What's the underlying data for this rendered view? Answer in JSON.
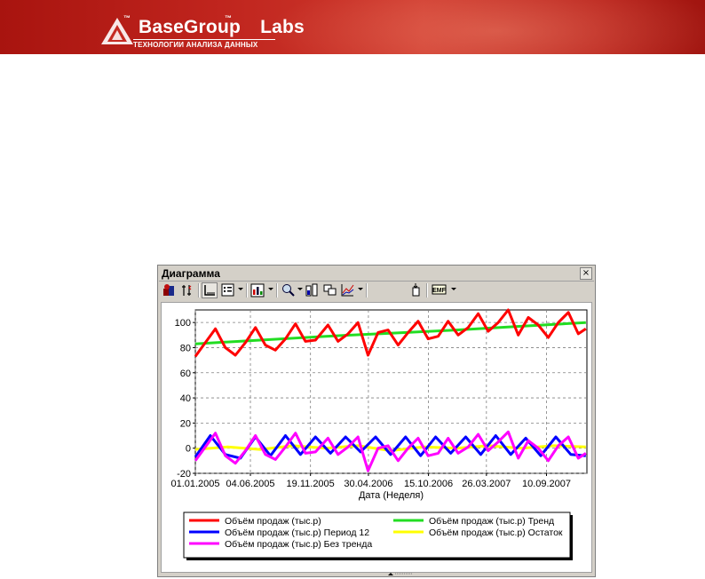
{
  "banner": {
    "brand_name": "BaseGroup",
    "brand_suffix": "Labs",
    "tm": "™",
    "tagline": "ТЕХНОЛОГИИ АНАЛИЗА ДАННЫХ",
    "colors": {
      "banner": "#b9221b",
      "text": "#ffffff"
    }
  },
  "window": {
    "title": "Диаграмма",
    "close_glyph": "×",
    "toolbar_icons": [
      "chart-wizard-icon",
      "axis-icon",
      "axes-icon",
      "legend-icon",
      "chart-type-icon",
      "zoom-icon",
      "stack-icon",
      "copy-icon",
      "series-icon",
      "export-icon",
      "emf-icon"
    ]
  },
  "chart_data": {
    "type": "line",
    "xlabel": "Дата (Неделя)",
    "x_ticks": [
      "01.01.2005",
      "04.06.2005",
      "19.11.2005",
      "30.04.2006",
      "15.10.2006",
      "26.03.2007",
      "10.09.2007"
    ],
    "y_ticks": [
      "100",
      "80",
      "60",
      "40",
      "20",
      "0",
      "-20"
    ],
    "ylim": [
      -20,
      110
    ],
    "xlim": [
      "2005-01-01",
      "2008-01-01"
    ],
    "grid": true,
    "legend_position": "bottom",
    "series": [
      {
        "name": "Объём продаж (тыс.р)",
        "color": "#ff0000",
        "points": [
          [
            "2005-01-01",
            73
          ],
          [
            "2005-01-29",
            84
          ],
          [
            "2005-02-26",
            95
          ],
          [
            "2005-03-26",
            80
          ],
          [
            "2005-04-23",
            74
          ],
          [
            "2005-05-21",
            84
          ],
          [
            "2005-06-18",
            96
          ],
          [
            "2005-07-16",
            82
          ],
          [
            "2005-08-13",
            78
          ],
          [
            "2005-09-10",
            87
          ],
          [
            "2005-10-08",
            99
          ],
          [
            "2005-11-05",
            85
          ],
          [
            "2005-12-03",
            86
          ],
          [
            "2006-01-07",
            98
          ],
          [
            "2006-02-04",
            85
          ],
          [
            "2006-03-04",
            91
          ],
          [
            "2006-04-01",
            100
          ],
          [
            "2006-04-29",
            74
          ],
          [
            "2006-05-27",
            92
          ],
          [
            "2006-06-24",
            94
          ],
          [
            "2006-07-22",
            82
          ],
          [
            "2006-08-19",
            92
          ],
          [
            "2006-09-16",
            101
          ],
          [
            "2006-10-14",
            87
          ],
          [
            "2006-11-11",
            89
          ],
          [
            "2006-12-09",
            101
          ],
          [
            "2007-01-06",
            90
          ],
          [
            "2007-02-03",
            96
          ],
          [
            "2007-03-03",
            107
          ],
          [
            "2007-03-31",
            93
          ],
          [
            "2007-04-28",
            100
          ],
          [
            "2007-05-26",
            110
          ],
          [
            "2007-06-23",
            90
          ],
          [
            "2007-07-21",
            104
          ],
          [
            "2007-08-18",
            98
          ],
          [
            "2007-09-15",
            88
          ],
          [
            "2007-10-13",
            100
          ],
          [
            "2007-11-10",
            108
          ],
          [
            "2007-12-08",
            91
          ],
          [
            "2007-12-29",
            95
          ]
        ]
      },
      {
        "name": "Объём продаж (тыс.р) Тренд",
        "color": "#22dd22",
        "points": [
          [
            "2005-01-01",
            83
          ],
          [
            "2005-07-01",
            86
          ],
          [
            "2006-01-01",
            89
          ],
          [
            "2006-07-01",
            91.5
          ],
          [
            "2007-01-01",
            94
          ],
          [
            "2007-07-01",
            97
          ],
          [
            "2007-12-29",
            100
          ]
        ]
      },
      {
        "name": "Объём продаж (тыс.р) Период 12",
        "color": "#0000ff",
        "points": [
          [
            "2005-01-01",
            -7
          ],
          [
            "2005-02-12",
            10
          ],
          [
            "2005-03-26",
            -5
          ],
          [
            "2005-05-07",
            -8
          ],
          [
            "2005-06-18",
            9
          ],
          [
            "2005-07-30",
            -6
          ],
          [
            "2005-09-10",
            10
          ],
          [
            "2005-10-22",
            -5
          ],
          [
            "2005-12-03",
            9
          ],
          [
            "2006-01-14",
            -4
          ],
          [
            "2006-02-25",
            9
          ],
          [
            "2006-04-08",
            -3
          ],
          [
            "2006-05-20",
            9
          ],
          [
            "2006-07-01",
            -5
          ],
          [
            "2006-08-12",
            9
          ],
          [
            "2006-09-23",
            -6
          ],
          [
            "2006-11-04",
            9
          ],
          [
            "2006-12-16",
            -4
          ],
          [
            "2007-01-27",
            9
          ],
          [
            "2007-03-10",
            -5
          ],
          [
            "2007-04-21",
            10
          ],
          [
            "2007-06-02",
            -5
          ],
          [
            "2007-07-14",
            8
          ],
          [
            "2007-08-25",
            -6
          ],
          [
            "2007-10-06",
            9
          ],
          [
            "2007-11-17",
            -5
          ],
          [
            "2007-12-29",
            -6
          ]
        ]
      },
      {
        "name": "Объём продаж (тыс.р) Остаток",
        "color": "#ffff00",
        "points": [
          [
            "2005-01-01",
            -1
          ],
          [
            "2005-04-01",
            1
          ],
          [
            "2005-07-01",
            -1
          ],
          [
            "2005-10-01",
            2
          ],
          [
            "2006-01-01",
            0
          ],
          [
            "2006-04-01",
            2
          ],
          [
            "2006-07-01",
            -2
          ],
          [
            "2006-10-01",
            1
          ],
          [
            "2007-01-01",
            0
          ],
          [
            "2007-04-01",
            2
          ],
          [
            "2007-07-01",
            0
          ],
          [
            "2007-10-01",
            2
          ],
          [
            "2007-12-29",
            1
          ]
        ]
      },
      {
        "name": "Объём продаж (тыс.р) Без тренда",
        "color": "#ff00ff",
        "points": [
          [
            "2005-01-01",
            -10
          ],
          [
            "2005-01-29",
            1
          ],
          [
            "2005-02-26",
            12
          ],
          [
            "2005-03-26",
            -6
          ],
          [
            "2005-04-23",
            -12
          ],
          [
            "2005-05-21",
            -2
          ],
          [
            "2005-06-18",
            10
          ],
          [
            "2005-07-16",
            -5
          ],
          [
            "2005-08-13",
            -9
          ],
          [
            "2005-09-10",
            1
          ],
          [
            "2005-10-08",
            12
          ],
          [
            "2005-11-05",
            -4
          ],
          [
            "2005-12-03",
            -3
          ],
          [
            "2006-01-07",
            8
          ],
          [
            "2006-02-04",
            -5
          ],
          [
            "2006-03-04",
            1
          ],
          [
            "2006-04-01",
            9
          ],
          [
            "2006-04-29",
            -18
          ],
          [
            "2006-05-27",
            0
          ],
          [
            "2006-06-24",
            2
          ],
          [
            "2006-07-22",
            -10
          ],
          [
            "2006-08-19",
            0
          ],
          [
            "2006-09-16",
            8
          ],
          [
            "2006-10-14",
            -6
          ],
          [
            "2006-11-11",
            -4
          ],
          [
            "2006-12-09",
            8
          ],
          [
            "2007-01-06",
            -4
          ],
          [
            "2007-02-03",
            1
          ],
          [
            "2007-03-03",
            11
          ],
          [
            "2007-03-31",
            -2
          ],
          [
            "2007-04-28",
            5
          ],
          [
            "2007-05-26",
            13
          ],
          [
            "2007-06-23",
            -8
          ],
          [
            "2007-07-21",
            6
          ],
          [
            "2007-08-18",
            0
          ],
          [
            "2007-09-15",
            -10
          ],
          [
            "2007-10-13",
            2
          ],
          [
            "2007-11-10",
            9
          ],
          [
            "2007-12-08",
            -8
          ],
          [
            "2007-12-29",
            -4
          ]
        ]
      }
    ]
  }
}
